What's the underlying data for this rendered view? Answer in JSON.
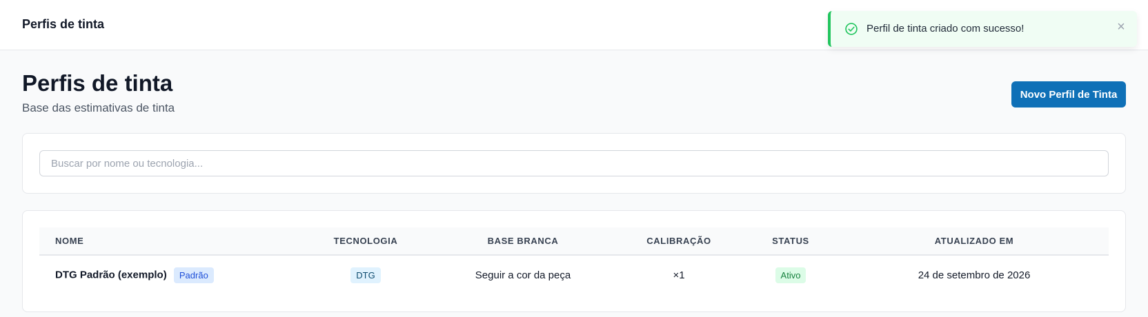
{
  "topbar": {
    "title": "Perfis de tinta"
  },
  "toast": {
    "message": "Perfil de tinta criado com sucesso!",
    "icon": "check-circle-icon",
    "close_icon": "close-icon",
    "close_glyph": "×",
    "color": "#22c55e"
  },
  "header": {
    "title": "Perfis de tinta",
    "subtitle": "Base das estimativas de tinta",
    "new_button_label": "Novo Perfil de Tinta",
    "accent": "#0f70b7"
  },
  "search": {
    "placeholder": "Buscar por nome ou tecnologia...",
    "value": ""
  },
  "table": {
    "columns": [
      "NOME",
      "TECNOLOGIA",
      "BASE BRANCA",
      "CALIBRAÇÃO",
      "STATUS",
      "ATUALIZADO EM"
    ],
    "rows": [
      {
        "name": "DTG Padrão (exemplo)",
        "default_badge": "Padrão",
        "technology": "DTG",
        "white_base": "Seguir a cor da peça",
        "calibration": "×1",
        "status": "Ativo",
        "updated_at": "24 de setembro de 2026"
      }
    ]
  }
}
